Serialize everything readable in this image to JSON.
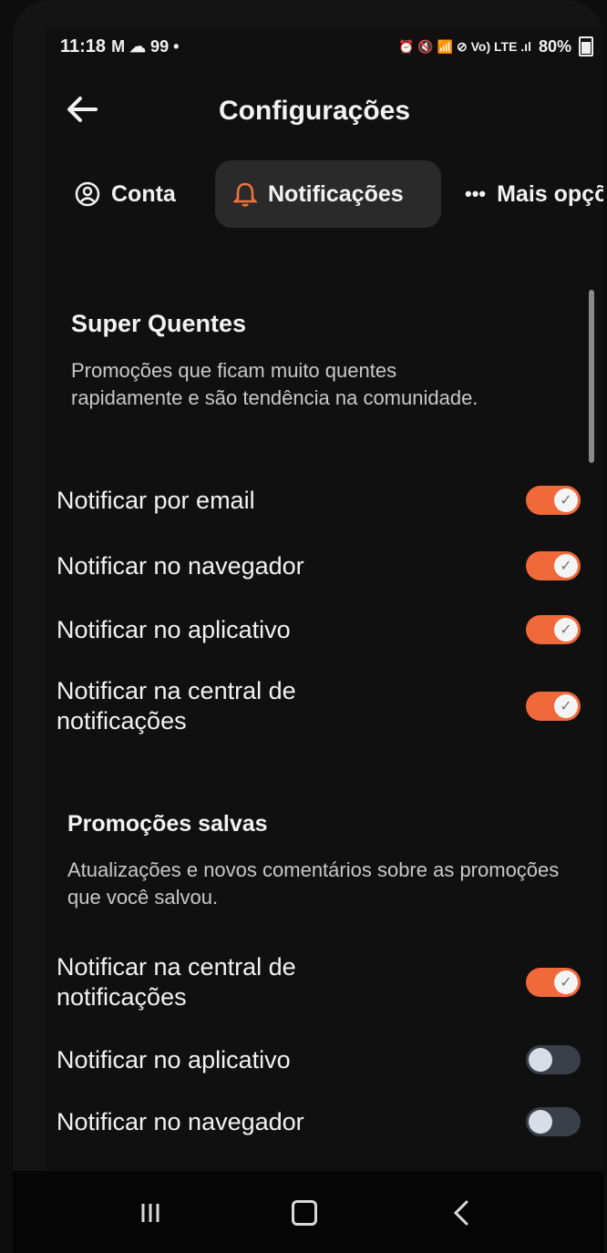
{
  "status": {
    "time": "11:18",
    "notif_icons": "M ☁ 99 •",
    "right_icons": "⏰ 🔇 📶 ⊘ Vo) LTE .ıl",
    "battery": "80%"
  },
  "header": {
    "title": "Configurações"
  },
  "tabs": [
    {
      "label": "Conta",
      "icon": "user-circle-icon"
    },
    {
      "label": "Notificações",
      "icon": "bell-icon",
      "selected": true
    },
    {
      "label": "Mais opçõ",
      "icon": "more-dots-icon"
    }
  ],
  "sections": [
    {
      "title": "Super Quentes",
      "description": "Promoções que ficam muito quentes rapidamente e são tendência na comunidade.",
      "rows": [
        {
          "label": "Notificar por email",
          "on": true
        },
        {
          "label": "Notificar no navegador",
          "on": true
        },
        {
          "label": "Notificar no aplicativo",
          "on": true
        },
        {
          "label": "Notificar na central de notificações",
          "on": true
        }
      ]
    },
    {
      "title": "Promoções salvas",
      "description": "Atualizações e novos comentários sobre as promoções que você salvou.",
      "rows": [
        {
          "label": "Notificar na central de notificações",
          "on": true
        },
        {
          "label": "Notificar no aplicativo",
          "on": false
        },
        {
          "label": "Notificar no navegador",
          "on": false
        }
      ]
    }
  ],
  "colors": {
    "accent": "#f0693a",
    "background": "#101010",
    "toggle_off": "#3a3f4a"
  }
}
